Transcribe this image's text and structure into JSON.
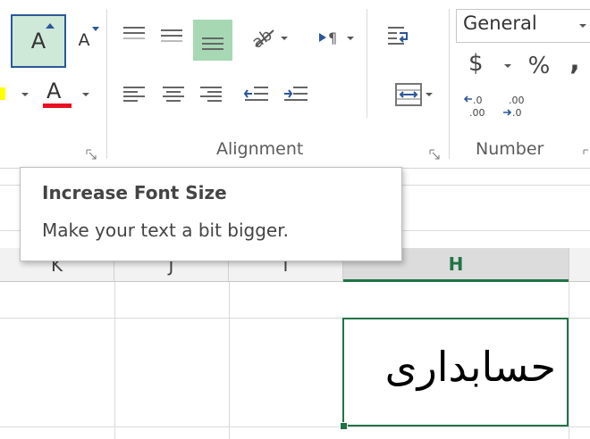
{
  "ribbon": {
    "font": {
      "increase_size_glyph": "A",
      "decrease_size_glyph": "A",
      "font_color_glyph": "A",
      "colors": {
        "font_color_bar": "#e81123",
        "highlight_bar": "#ffff00",
        "pressed_bg": "#cfe9d8",
        "pressed_border": "#2b579a"
      }
    },
    "alignment": {
      "label": "Alignment",
      "pressed_bg": "#a7d8b4"
    },
    "number": {
      "label": "Number",
      "format_value": "General",
      "currency_glyph": "$",
      "percent_glyph": "%",
      "comma_glyph": ","
    }
  },
  "tooltip": {
    "title": "Increase Font Size",
    "description": "Make your text a bit bigger."
  },
  "sheet": {
    "columns": [
      {
        "label": "K",
        "selected": false
      },
      {
        "label": "J",
        "selected": false
      },
      {
        "label": "I",
        "selected": false
      },
      {
        "label": "H",
        "selected": true
      }
    ],
    "selected_header_color": "#217346",
    "active_cell_text": "حسابداری"
  }
}
